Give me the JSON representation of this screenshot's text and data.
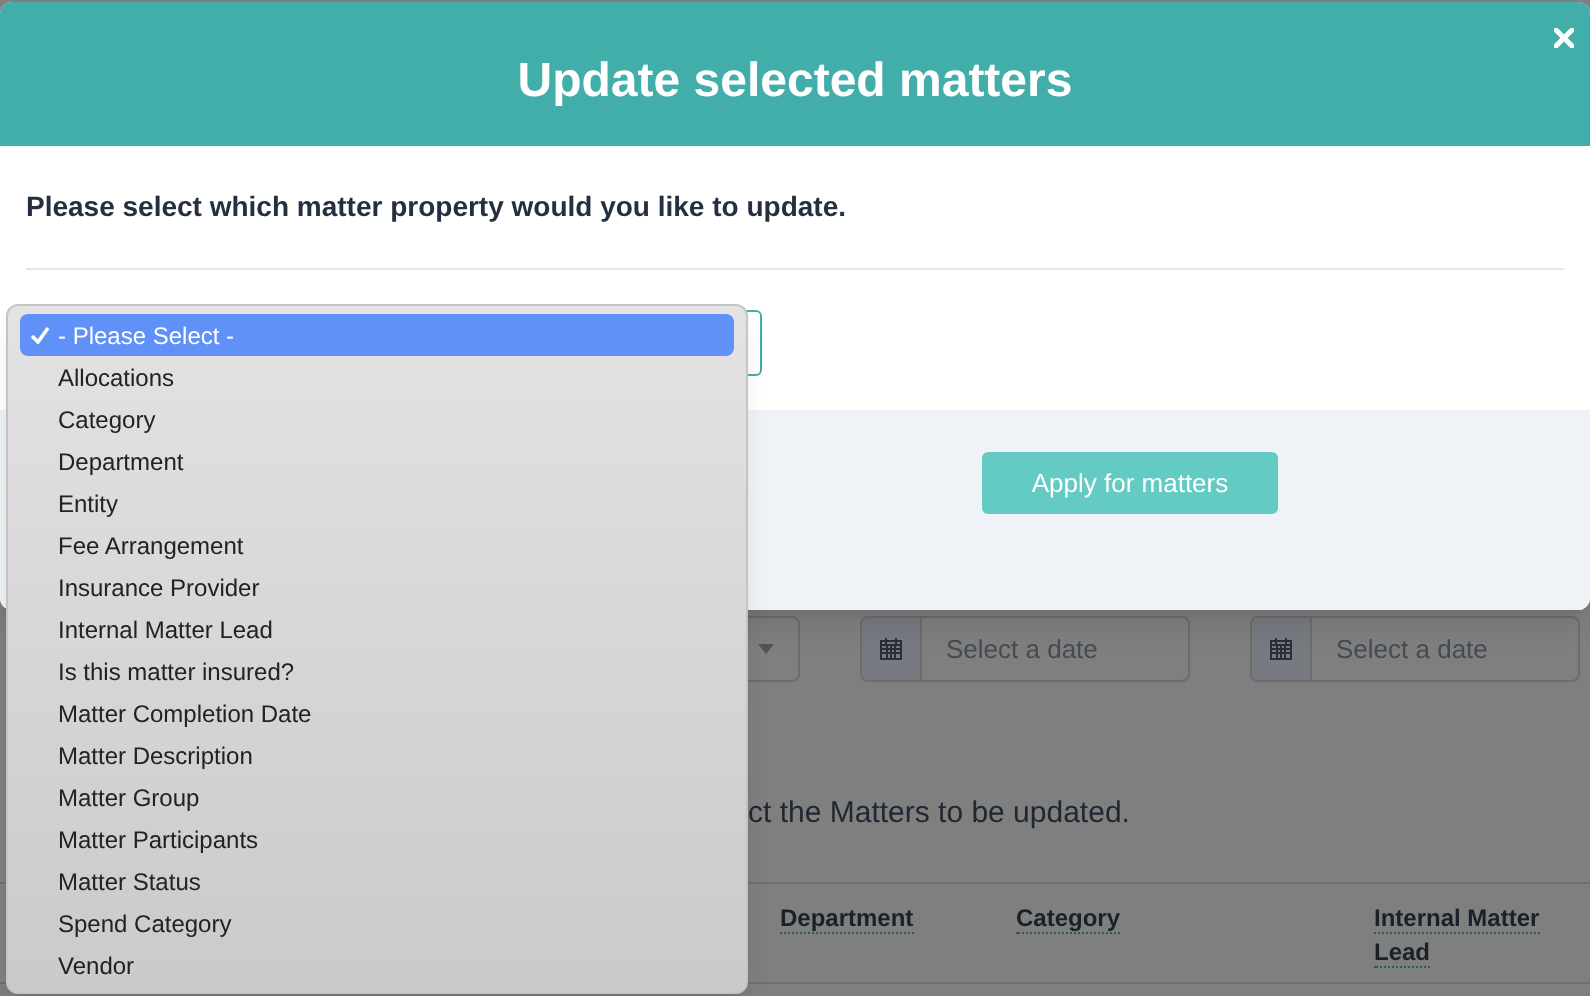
{
  "modal": {
    "title": "Update selected matters",
    "prompt": "Please select which matter property would you like to update.",
    "apply_button": {
      "label": "Apply for matters",
      "disabled": true
    }
  },
  "dropdown": {
    "options": [
      {
        "label": "- Please Select -",
        "selected": true
      },
      {
        "label": "Allocations",
        "selected": false
      },
      {
        "label": "Category",
        "selected": false
      },
      {
        "label": "Department",
        "selected": false
      },
      {
        "label": "Entity",
        "selected": false
      },
      {
        "label": "Fee Arrangement",
        "selected": false
      },
      {
        "label": "Insurance Provider",
        "selected": false
      },
      {
        "label": "Internal Matter Lead",
        "selected": false
      },
      {
        "label": "Is this matter insured?",
        "selected": false
      },
      {
        "label": "Matter Completion Date",
        "selected": false
      },
      {
        "label": "Matter Description",
        "selected": false
      },
      {
        "label": "Matter Group",
        "selected": false
      },
      {
        "label": "Matter Participants",
        "selected": false
      },
      {
        "label": "Matter Status",
        "selected": false
      },
      {
        "label": "Spend Category",
        "selected": false
      },
      {
        "label": "Vendor",
        "selected": false
      }
    ]
  },
  "background": {
    "date_fields": [
      {
        "placeholder": "Select a date"
      },
      {
        "placeholder": "Select a date"
      }
    ],
    "instruction": "ct the Matters to be updated.",
    "columns": [
      "Department",
      "Category",
      "Internal Matter Lead"
    ]
  }
}
